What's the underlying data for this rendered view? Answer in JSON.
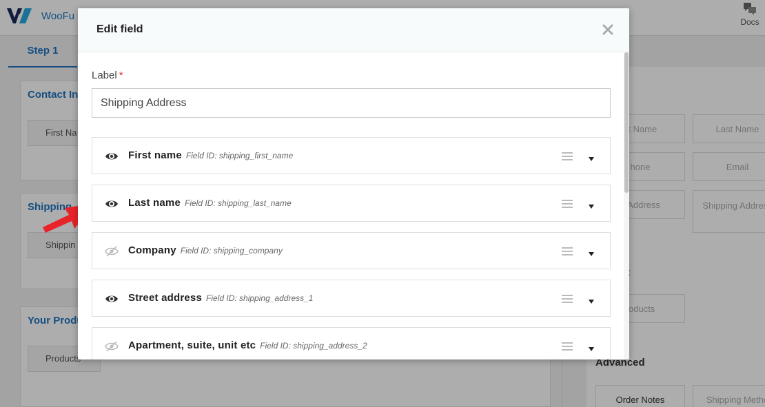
{
  "app": {
    "brand": "WooFu",
    "docs_label": "Docs"
  },
  "background": {
    "step_tab": "Step 1",
    "sections": [
      {
        "title": "Contact Inf",
        "chip": "First Na"
      },
      {
        "title": "Shipping",
        "chip": "Shippin"
      },
      {
        "title": "Your Produ",
        "chip": "Products"
      }
    ],
    "right_panel": {
      "chips": [
        "st Name",
        "Last Name",
        "hone",
        "Email",
        "g Address",
        "Shipping Address",
        "roducts",
        "Order Notes",
        "Shipping Metho"
      ],
      "headings": [
        "t",
        "Advanced"
      ]
    }
  },
  "modal": {
    "title": "Edit field",
    "label_text": "Label",
    "required_mark": "*",
    "label_value": "Shipping Address",
    "field_id_prefix": "Field ID: ",
    "fields": [
      {
        "name": "First name",
        "field_id": "shipping_first_name",
        "visible": true
      },
      {
        "name": "Last name",
        "field_id": "shipping_last_name",
        "visible": true
      },
      {
        "name": "Company",
        "field_id": "shipping_company",
        "visible": false
      },
      {
        "name": "Street address",
        "field_id": "shipping_address_1",
        "visible": true
      },
      {
        "name": "Apartment, suite, unit etc",
        "field_id": "shipping_address_2",
        "visible": false
      }
    ]
  },
  "icons": {
    "visible": "eye-icon",
    "hidden": "eye-slash-icon",
    "drag": "drag-handle-icon",
    "expand": "caret-down-icon",
    "close": "close-icon",
    "docs": "chat-bubbles-icon"
  },
  "colors": {
    "accent": "#1e73be",
    "required": "#d9363e",
    "arrow": "#e8232a"
  }
}
